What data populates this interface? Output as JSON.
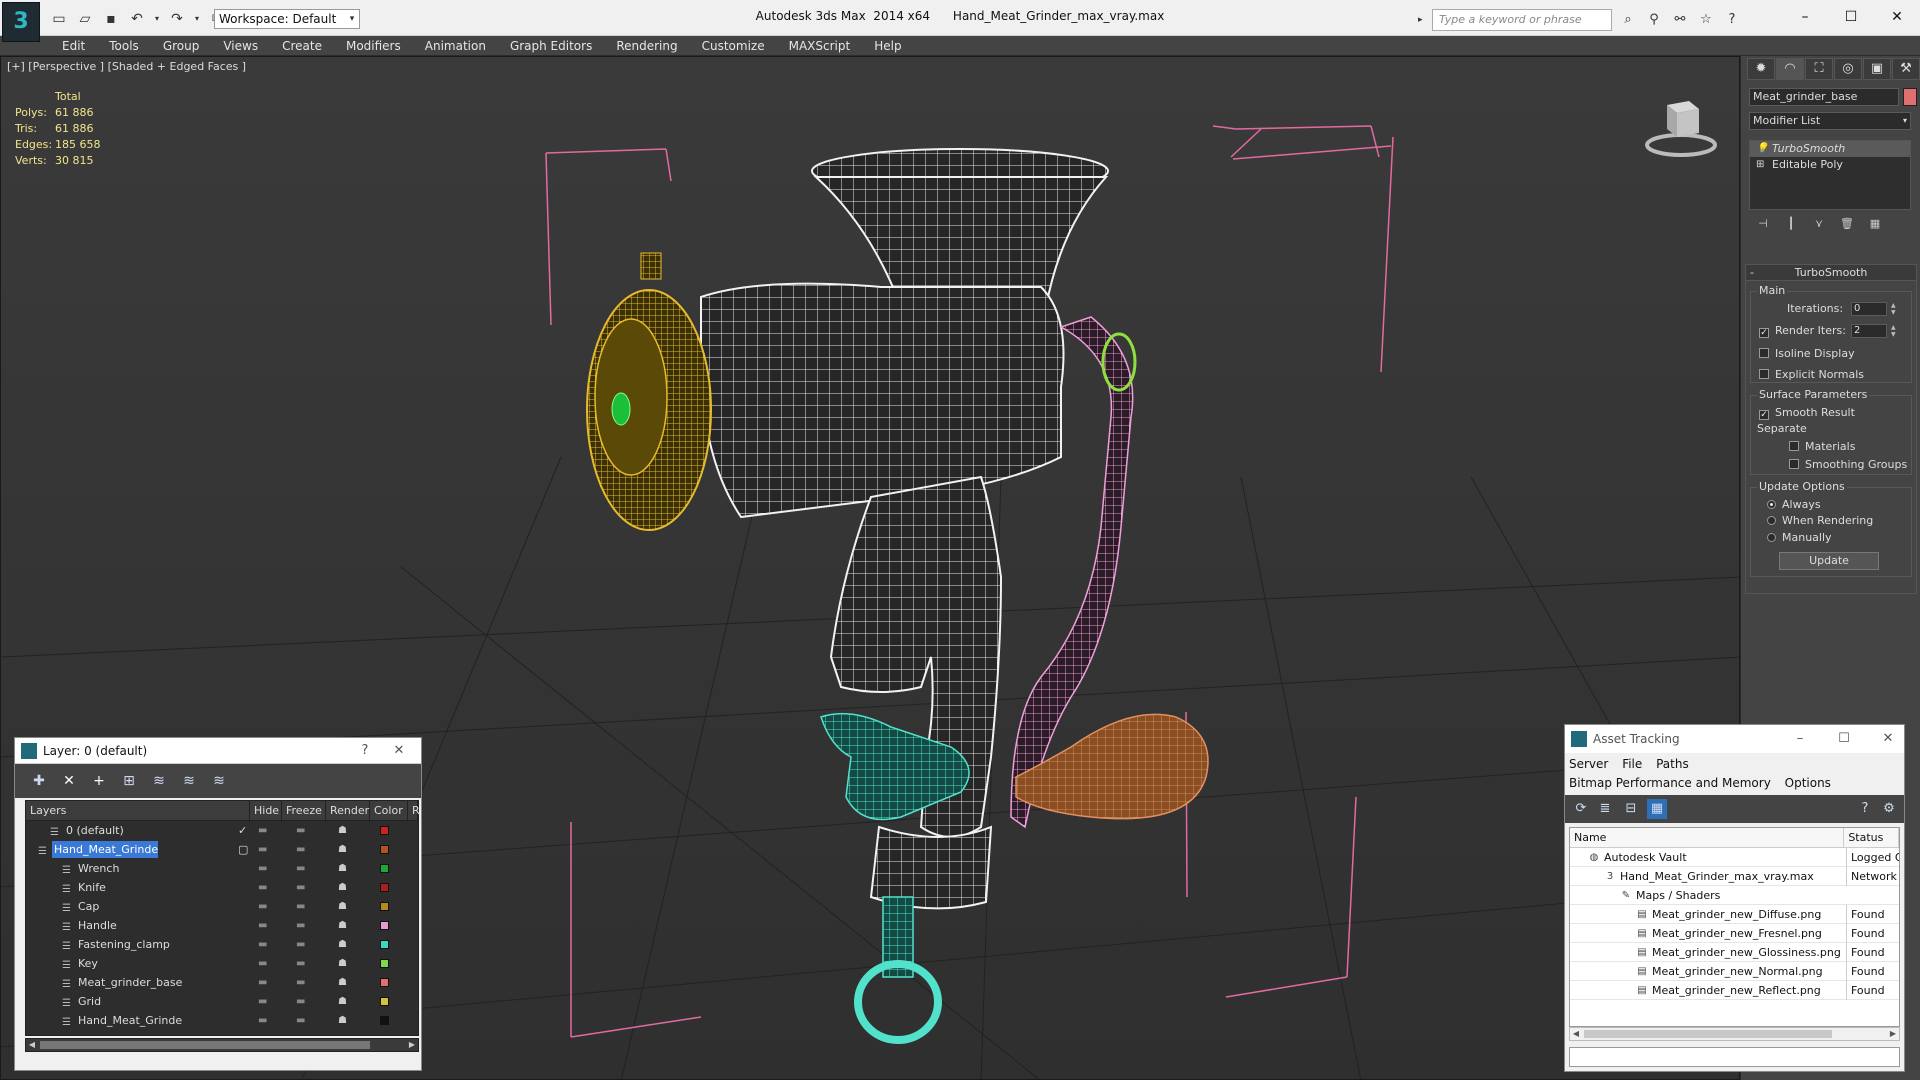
{
  "titlebar": {
    "app_logo": "3",
    "workspace": "Workspace: Default",
    "title": "Autodesk 3ds Max  2014 x64      Hand_Meat_Grinder_max_vray.max",
    "search_placeholder": "Type a keyword or phrase"
  },
  "menu": [
    "Edit",
    "Tools",
    "Group",
    "Views",
    "Create",
    "Modifiers",
    "Animation",
    "Graph Editors",
    "Rendering",
    "Customize",
    "MAXScript",
    "Help"
  ],
  "viewport": {
    "label": "[+] [Perspective ] [Shaded + Edged Faces ]",
    "stats": {
      "header": "Total",
      "rows": [
        {
          "k": "Polys:",
          "v": "61 886"
        },
        {
          "k": "Tris:",
          "v": "61 886"
        },
        {
          "k": "Edges:",
          "v": "185 658"
        },
        {
          "k": "Verts:",
          "v": "30 815"
        }
      ]
    }
  },
  "command_panel": {
    "object_name": "Meat_grinder_base",
    "object_color": "#e07070",
    "modifier_list": "Modifier List",
    "stack": [
      "TurboSmooth",
      "Editable Poly"
    ],
    "turbosmooth": {
      "title": "TurboSmooth",
      "main_label": "Main",
      "iterations_label": "Iterations:",
      "iterations_value": "0",
      "render_iters_label": "Render Iters:",
      "render_iters_value": "2",
      "isoline": "Isoline Display",
      "explicit": "Explicit Normals",
      "surface_label": "Surface Parameters",
      "smooth_result": "Smooth Result",
      "separate": "Separate",
      "materials": "Materials",
      "smoothing_groups": "Smoothing Groups",
      "update_label": "Update Options",
      "always": "Always",
      "when_rendering": "When Rendering",
      "manually": "Manually",
      "update_btn": "Update"
    }
  },
  "layer_panel": {
    "title": "Layer: 0 (default)",
    "help": "?",
    "columns": [
      "Layers",
      "Hide",
      "Freeze",
      "Render",
      "Color",
      "R"
    ],
    "rows": [
      {
        "name": "0 (default)",
        "indent": 1,
        "color": "#cc2222",
        "check": "✓",
        "selected": false
      },
      {
        "name": "Hand_Meat_Grinde",
        "indent": 0,
        "color": "#b4531f",
        "check": "▢",
        "selected": true
      },
      {
        "name": "Wrench",
        "indent": 2,
        "color": "#1fa83a",
        "check": "",
        "selected": false
      },
      {
        "name": "Knife",
        "indent": 2,
        "color": "#a81f1f",
        "check": "",
        "selected": false
      },
      {
        "name": "Cap",
        "indent": 2,
        "color": "#b48a1f",
        "check": "",
        "selected": false
      },
      {
        "name": "Handle",
        "indent": 2,
        "color": "#e59ad0",
        "check": "",
        "selected": false
      },
      {
        "name": "Fastening_clamp",
        "indent": 2,
        "color": "#3fd6c0",
        "check": "",
        "selected": false
      },
      {
        "name": "Key",
        "indent": 2,
        "color": "#7fd64f",
        "check": "",
        "selected": false
      },
      {
        "name": "Meat_grinder_base",
        "indent": 2,
        "color": "#e07070",
        "check": "",
        "selected": false
      },
      {
        "name": "Grid",
        "indent": 2,
        "color": "#d6c13f",
        "check": "",
        "selected": false
      },
      {
        "name": "Hand_Meat_Grinde",
        "indent": 2,
        "color": "#111111",
        "check": "",
        "selected": false
      }
    ]
  },
  "asset_panel": {
    "title": "Asset Tracking",
    "menu": [
      "Server",
      "File",
      "Paths",
      "Bitmap Performance and Memory",
      "Options"
    ],
    "columns": [
      "Name",
      "Status"
    ],
    "rows": [
      {
        "name": "Autodesk Vault",
        "indent": 1,
        "icon": "vault-icon",
        "glyph": "◍",
        "status": "Logged O"
      },
      {
        "name": "Hand_Meat_Grinder_max_vray.max",
        "indent": 2,
        "icon": "max-file-icon",
        "glyph": "3",
        "status": "Network P"
      },
      {
        "name": "Maps / Shaders",
        "indent": 3,
        "icon": "maps-icon",
        "glyph": "✎",
        "status": ""
      },
      {
        "name": "Meat_grinder_new_Diffuse.png",
        "indent": 4,
        "icon": "image-file-icon",
        "glyph": "▤",
        "status": "Found"
      },
      {
        "name": "Meat_grinder_new_Fresnel.png",
        "indent": 4,
        "icon": "image-file-icon",
        "glyph": "▤",
        "status": "Found"
      },
      {
        "name": "Meat_grinder_new_Glossiness.png",
        "indent": 4,
        "icon": "image-file-icon",
        "glyph": "▤",
        "status": "Found"
      },
      {
        "name": "Meat_grinder_new_Normal.png",
        "indent": 4,
        "icon": "image-file-icon",
        "glyph": "▤",
        "status": "Found"
      },
      {
        "name": "Meat_grinder_new_Reflect.png",
        "indent": 4,
        "icon": "image-file-icon",
        "glyph": "▤",
        "status": "Found"
      }
    ]
  }
}
